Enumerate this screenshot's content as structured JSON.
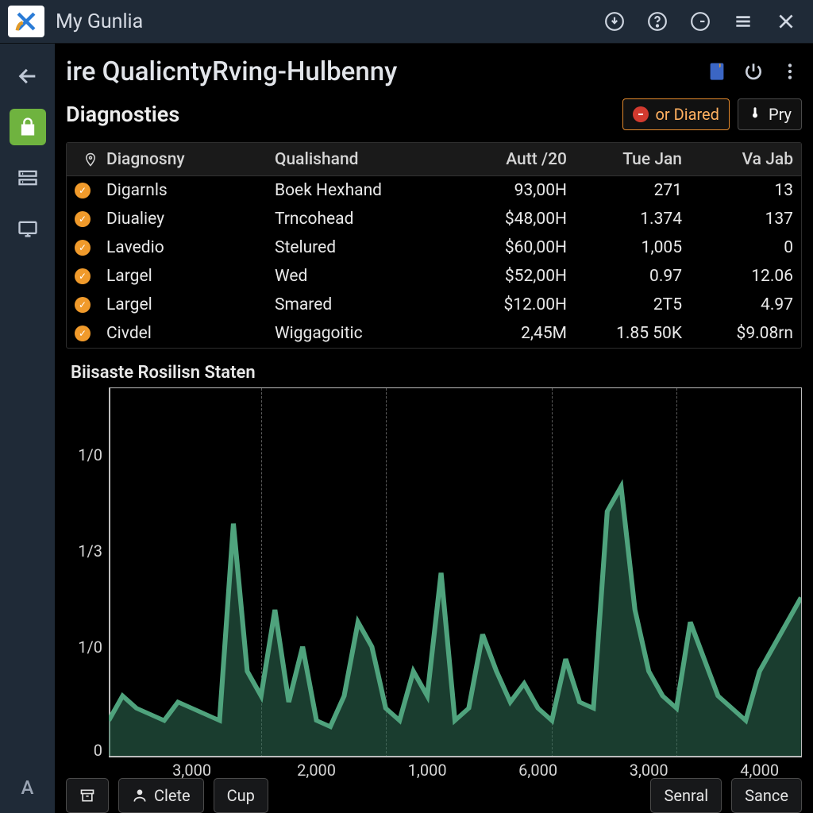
{
  "app": {
    "title": "My Gunlia"
  },
  "titlebar_icons": [
    "download-icon",
    "help-icon",
    "clock-icon",
    "settings-icon",
    "close-icon"
  ],
  "sidebar": {
    "items": [
      {
        "name": "back",
        "active": false
      },
      {
        "name": "secure",
        "active": true
      },
      {
        "name": "panel",
        "active": false
      },
      {
        "name": "device",
        "active": false
      }
    ],
    "bottom_label": "A"
  },
  "page": {
    "title": "ire QualicntyRving-Hulbenny",
    "subtitle": "Diagnosties",
    "header_actions": [
      "note-icon",
      "power-icon",
      "kebab-icon"
    ],
    "btn_diared": "or Diared",
    "btn_pry": "Pry"
  },
  "table": {
    "headers": [
      "Diagnosny",
      "Qualishand",
      "Autt /20",
      "Tue Jan",
      "Va Jab"
    ],
    "rows": [
      {
        "c1": "Digarnls",
        "c2": "Boek Hexhand",
        "c3": "93,00H",
        "c4": "271",
        "c5": "13"
      },
      {
        "c1": "Diualiey",
        "c2": "Trncohead",
        "c3": "$48,00H",
        "c4": "1.374",
        "c5": "137"
      },
      {
        "c1": "Lavedio",
        "c2": "Stelured",
        "c3": "$60,00H",
        "c4": "1,005",
        "c5": "0"
      },
      {
        "c1": "Largel",
        "c2": "Wed",
        "c3": "$52,00H",
        "c4": "0.97",
        "c5": "12.06"
      },
      {
        "c1": "Largel",
        "c2": "Smared",
        "c3": "$12.00H",
        "c4": "2T5",
        "c5": "4.97"
      },
      {
        "c1": "Civdel",
        "c2": "Wiggagoitic",
        "c3": "2,45M",
        "c4": "1.85 50K",
        "c5": "$9.08rn"
      }
    ]
  },
  "chart_data": {
    "type": "area",
    "title": "Biisaste Rosilisn Staten",
    "ylabel": "",
    "xlabel": "",
    "y_ticks": [
      "1/0",
      "1/3",
      "1/0",
      "0"
    ],
    "x_ticks": [
      "3,000",
      "2,000",
      "1,000",
      "6,000",
      "3,000",
      "4,000"
    ],
    "x": [
      0,
      2,
      4,
      6,
      8,
      10,
      12,
      14,
      16,
      18,
      20,
      22,
      24,
      26,
      28,
      30,
      32,
      34,
      36,
      38,
      40,
      42,
      44,
      46,
      48,
      50,
      52,
      54,
      56,
      58,
      60,
      62,
      64,
      66,
      68,
      70,
      72,
      74,
      76,
      78,
      80,
      82,
      84,
      86,
      88,
      90,
      92,
      94,
      96,
      98,
      100
    ],
    "y": [
      6,
      10,
      8,
      7,
      6,
      9,
      8,
      7,
      6,
      38,
      14,
      10,
      24,
      9,
      18,
      6,
      5,
      10,
      22,
      18,
      8,
      6,
      14,
      10,
      30,
      6,
      8,
      20,
      14,
      9,
      12,
      8,
      6,
      16,
      9,
      8,
      40,
      44,
      24,
      14,
      10,
      8,
      22,
      16,
      10,
      8,
      6,
      14,
      18,
      22,
      26
    ],
    "ylim": [
      0,
      60
    ],
    "series_color": "#2f6f55"
  },
  "footer": {
    "btn_archive": "",
    "btn_clete": "Clete",
    "btn_cup": "Cup",
    "btn_senral": "Senral",
    "btn_sance": "Sance"
  }
}
